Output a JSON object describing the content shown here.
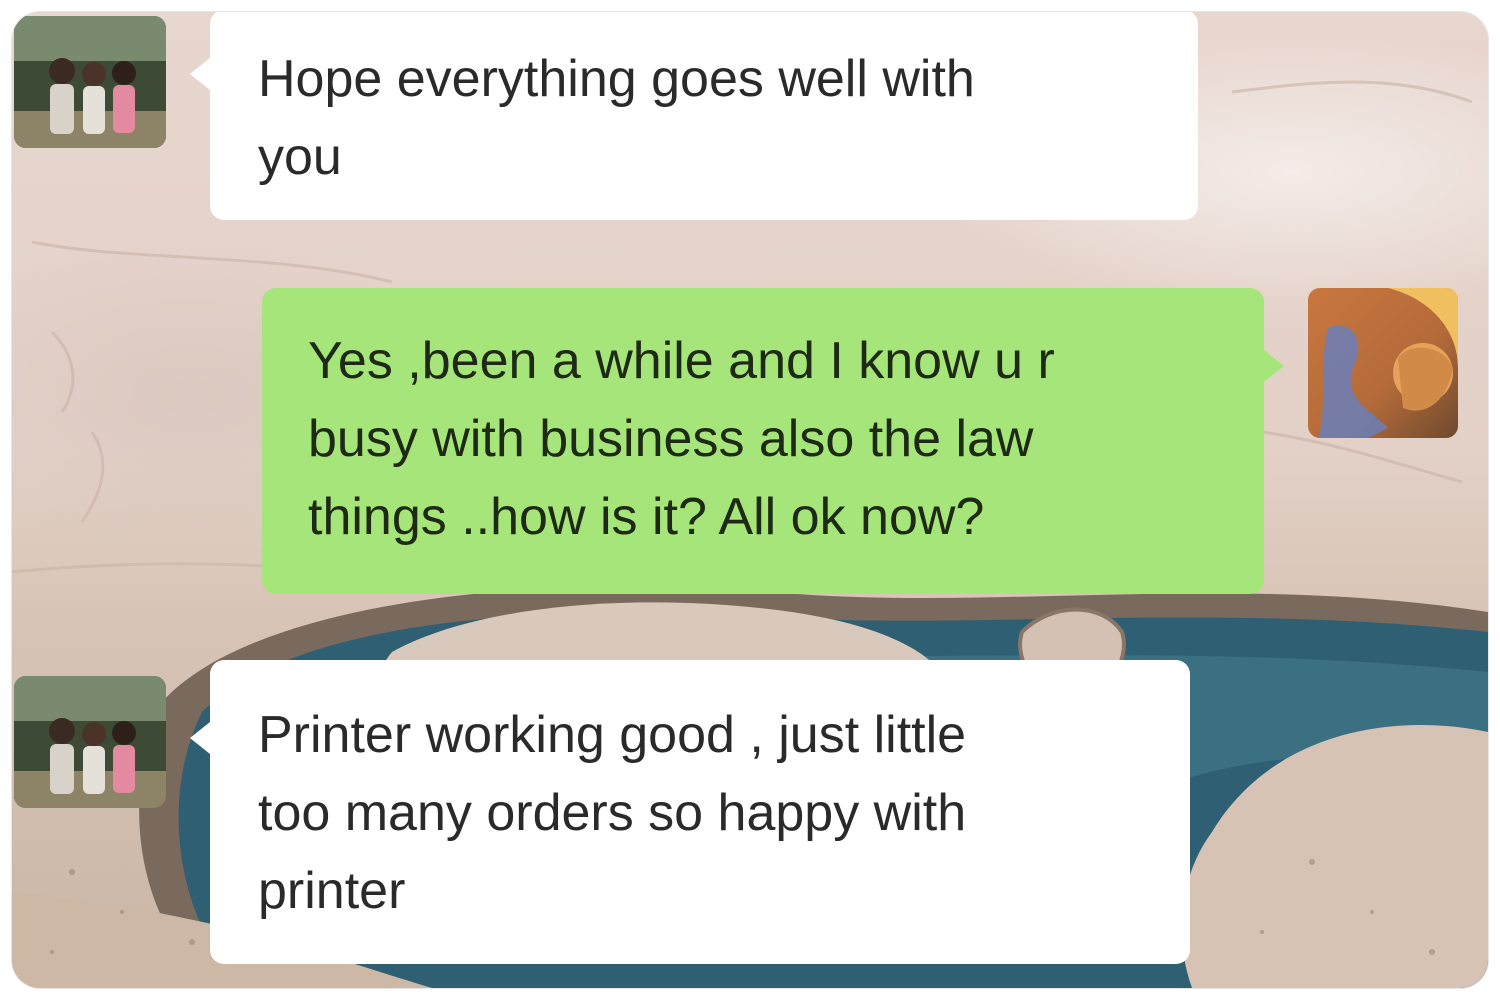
{
  "chat": {
    "messages": [
      {
        "direction": "incoming",
        "avatar": "contact-photo-avatar",
        "lines": [
          "Hope everything goes well with",
          "you"
        ]
      },
      {
        "direction": "outgoing",
        "avatar": "user-avatar",
        "lines": [
          "Yes ,been a while and I know u r",
          "busy with business also the law",
          "things ..how is it? All ok now?"
        ]
      },
      {
        "direction": "incoming",
        "avatar": "contact-photo-avatar",
        "lines": [
          "Printer working good , just little",
          "too many orders so happy with",
          "printer"
        ]
      }
    ]
  },
  "colors": {
    "incoming_bubble": "#ffffff",
    "outgoing_bubble": "#a5e57a",
    "text": "#2a2a2a"
  }
}
